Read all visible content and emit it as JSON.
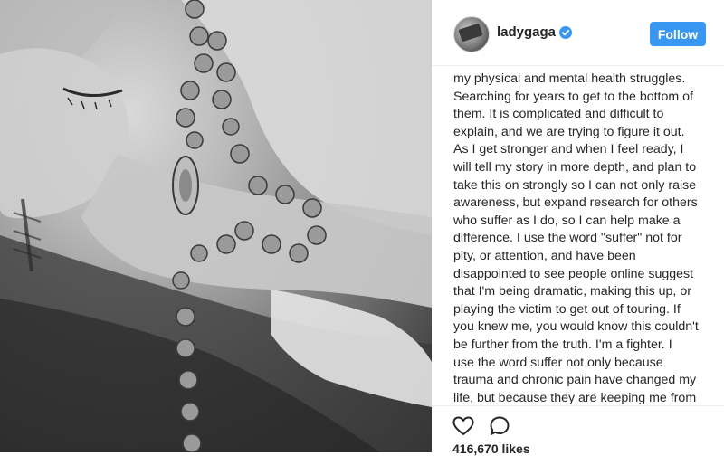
{
  "post": {
    "username": "ladygaga",
    "follow_label": "Follow",
    "caption": "my physical and mental health struggles.\nSearching for years to get to the bottom of\nthem. It is complicated and difficult to\nexplain, and we are trying to figure it out.\nAs I get stronger and when I feel ready, I\nwill tell my story in more depth, and plan to\ntake this on strongly so I can not only raise\nawareness, but expand research for others\nwho suffer as I do, so I can help make a\ndifference. I use the word \"suffer\" not for\npity, or attention, and have been\ndisappointed to see people online suggest\nthat I'm being dramatic, making this up, or\nplaying the victim to get out of touring. If\nyou knew me, you would know this couldn't\nbe further from the truth. I'm a fighter. I\nuse the word suffer not only because\ntrauma and chronic pain have changed my\nlife, but because they are keeping me from\nliving a normal life. They are also keeping\nme from what I love the most in the world:",
    "likes": "416,670 likes"
  },
  "icons": {
    "verified": "verified-badge-icon",
    "like": "heart-icon",
    "comment": "comment-icon"
  },
  "colors": {
    "follow_button": "#3897f0",
    "verified_badge": "#3897f0",
    "text": "#262626",
    "divider": "#efefef"
  }
}
